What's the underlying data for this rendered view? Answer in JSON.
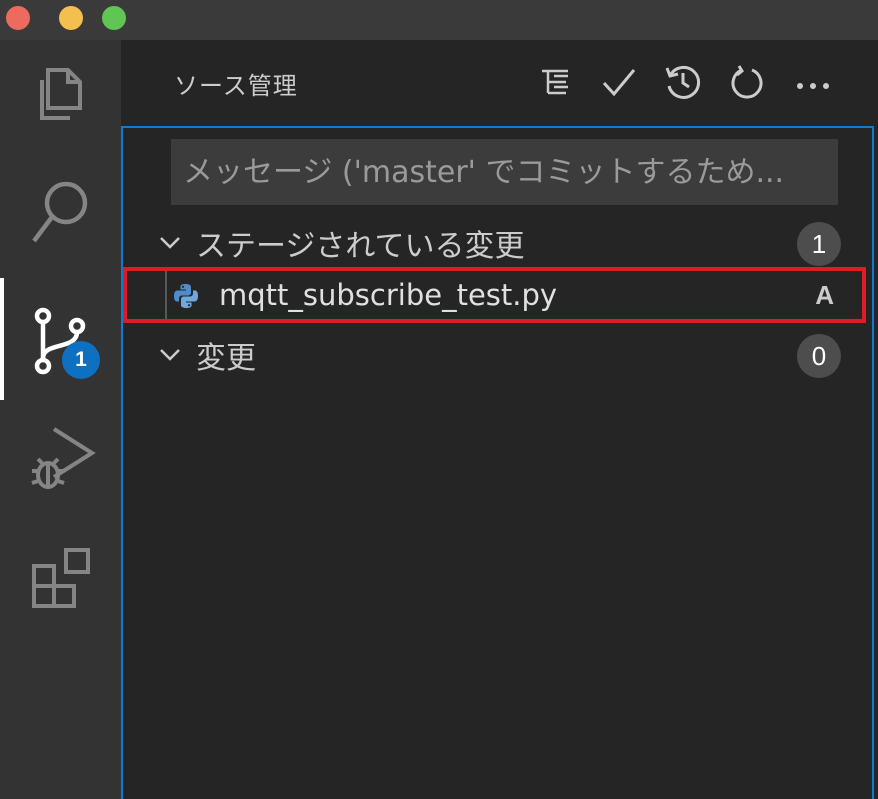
{
  "window": {
    "traffic_lights": [
      "close",
      "minimize",
      "zoom"
    ],
    "colors": {
      "close": "#ed6a5e",
      "minimize": "#f5bf4f",
      "zoom": "#61c554"
    }
  },
  "activity_bar": {
    "items": [
      {
        "icon": "files-icon"
      },
      {
        "icon": "search-icon"
      },
      {
        "icon": "source-control-icon",
        "badge": "1",
        "active": true
      },
      {
        "icon": "run-debug-icon"
      },
      {
        "icon": "extensions-icon"
      }
    ],
    "accent": "#0e70c0"
  },
  "scm": {
    "title": "ソース管理",
    "toolbar": [
      "view-as-tree-icon",
      "commit-check-icon",
      "history-icon",
      "refresh-icon",
      "more-actions-icon"
    ],
    "commit_placeholder": "メッセージ ('master' でコミットするため...",
    "sections": [
      {
        "title": "ステージされている変更",
        "count": "1",
        "files": [
          {
            "name": "mqtt_subscribe_test.py",
            "status": "A",
            "icon": "python-file-icon"
          }
        ]
      },
      {
        "title": "変更",
        "count": "0",
        "files": []
      }
    ],
    "highlight_color": "#e01b24"
  }
}
